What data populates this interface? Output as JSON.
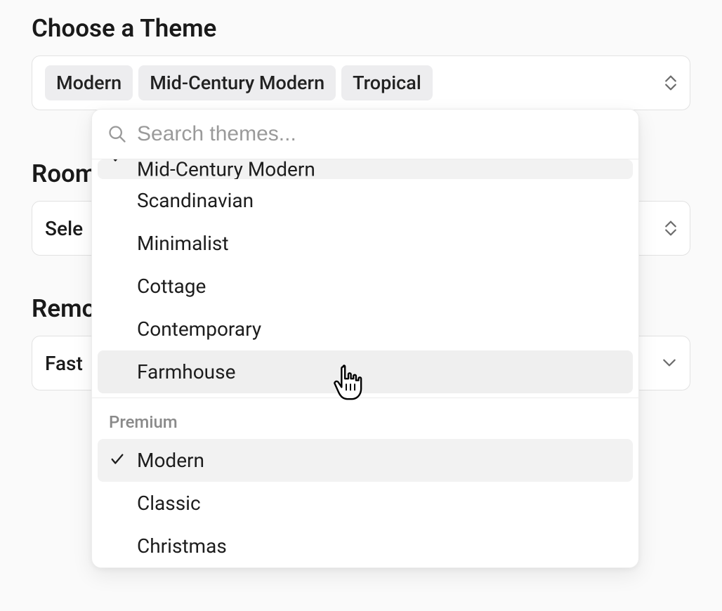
{
  "theme_field": {
    "label": "Choose a Theme",
    "selected_chips": [
      "Modern",
      "Mid-Century Modern",
      "Tropical"
    ]
  },
  "room_field": {
    "label": "Room",
    "placeholder_visible": "Sele"
  },
  "remodel_field": {
    "label": "Remo",
    "placeholder_visible": "Fast"
  },
  "dropdown": {
    "search_placeholder": "Search themes...",
    "cutoff_option": "Mid-Century Modern",
    "options_top": [
      {
        "label": "Scandinavian",
        "checked": false,
        "hovered": false
      },
      {
        "label": "Minimalist",
        "checked": false,
        "hovered": false
      },
      {
        "label": "Cottage",
        "checked": false,
        "hovered": false
      },
      {
        "label": "Contemporary",
        "checked": false,
        "hovered": false
      },
      {
        "label": "Farmhouse",
        "checked": false,
        "hovered": true
      }
    ],
    "group_label": "Premium",
    "options_bottom": [
      {
        "label": "Modern",
        "checked": true,
        "hovered": false
      },
      {
        "label": "Classic",
        "checked": false,
        "hovered": false
      },
      {
        "label": "Christmas",
        "checked": false,
        "hovered": false
      }
    ]
  }
}
